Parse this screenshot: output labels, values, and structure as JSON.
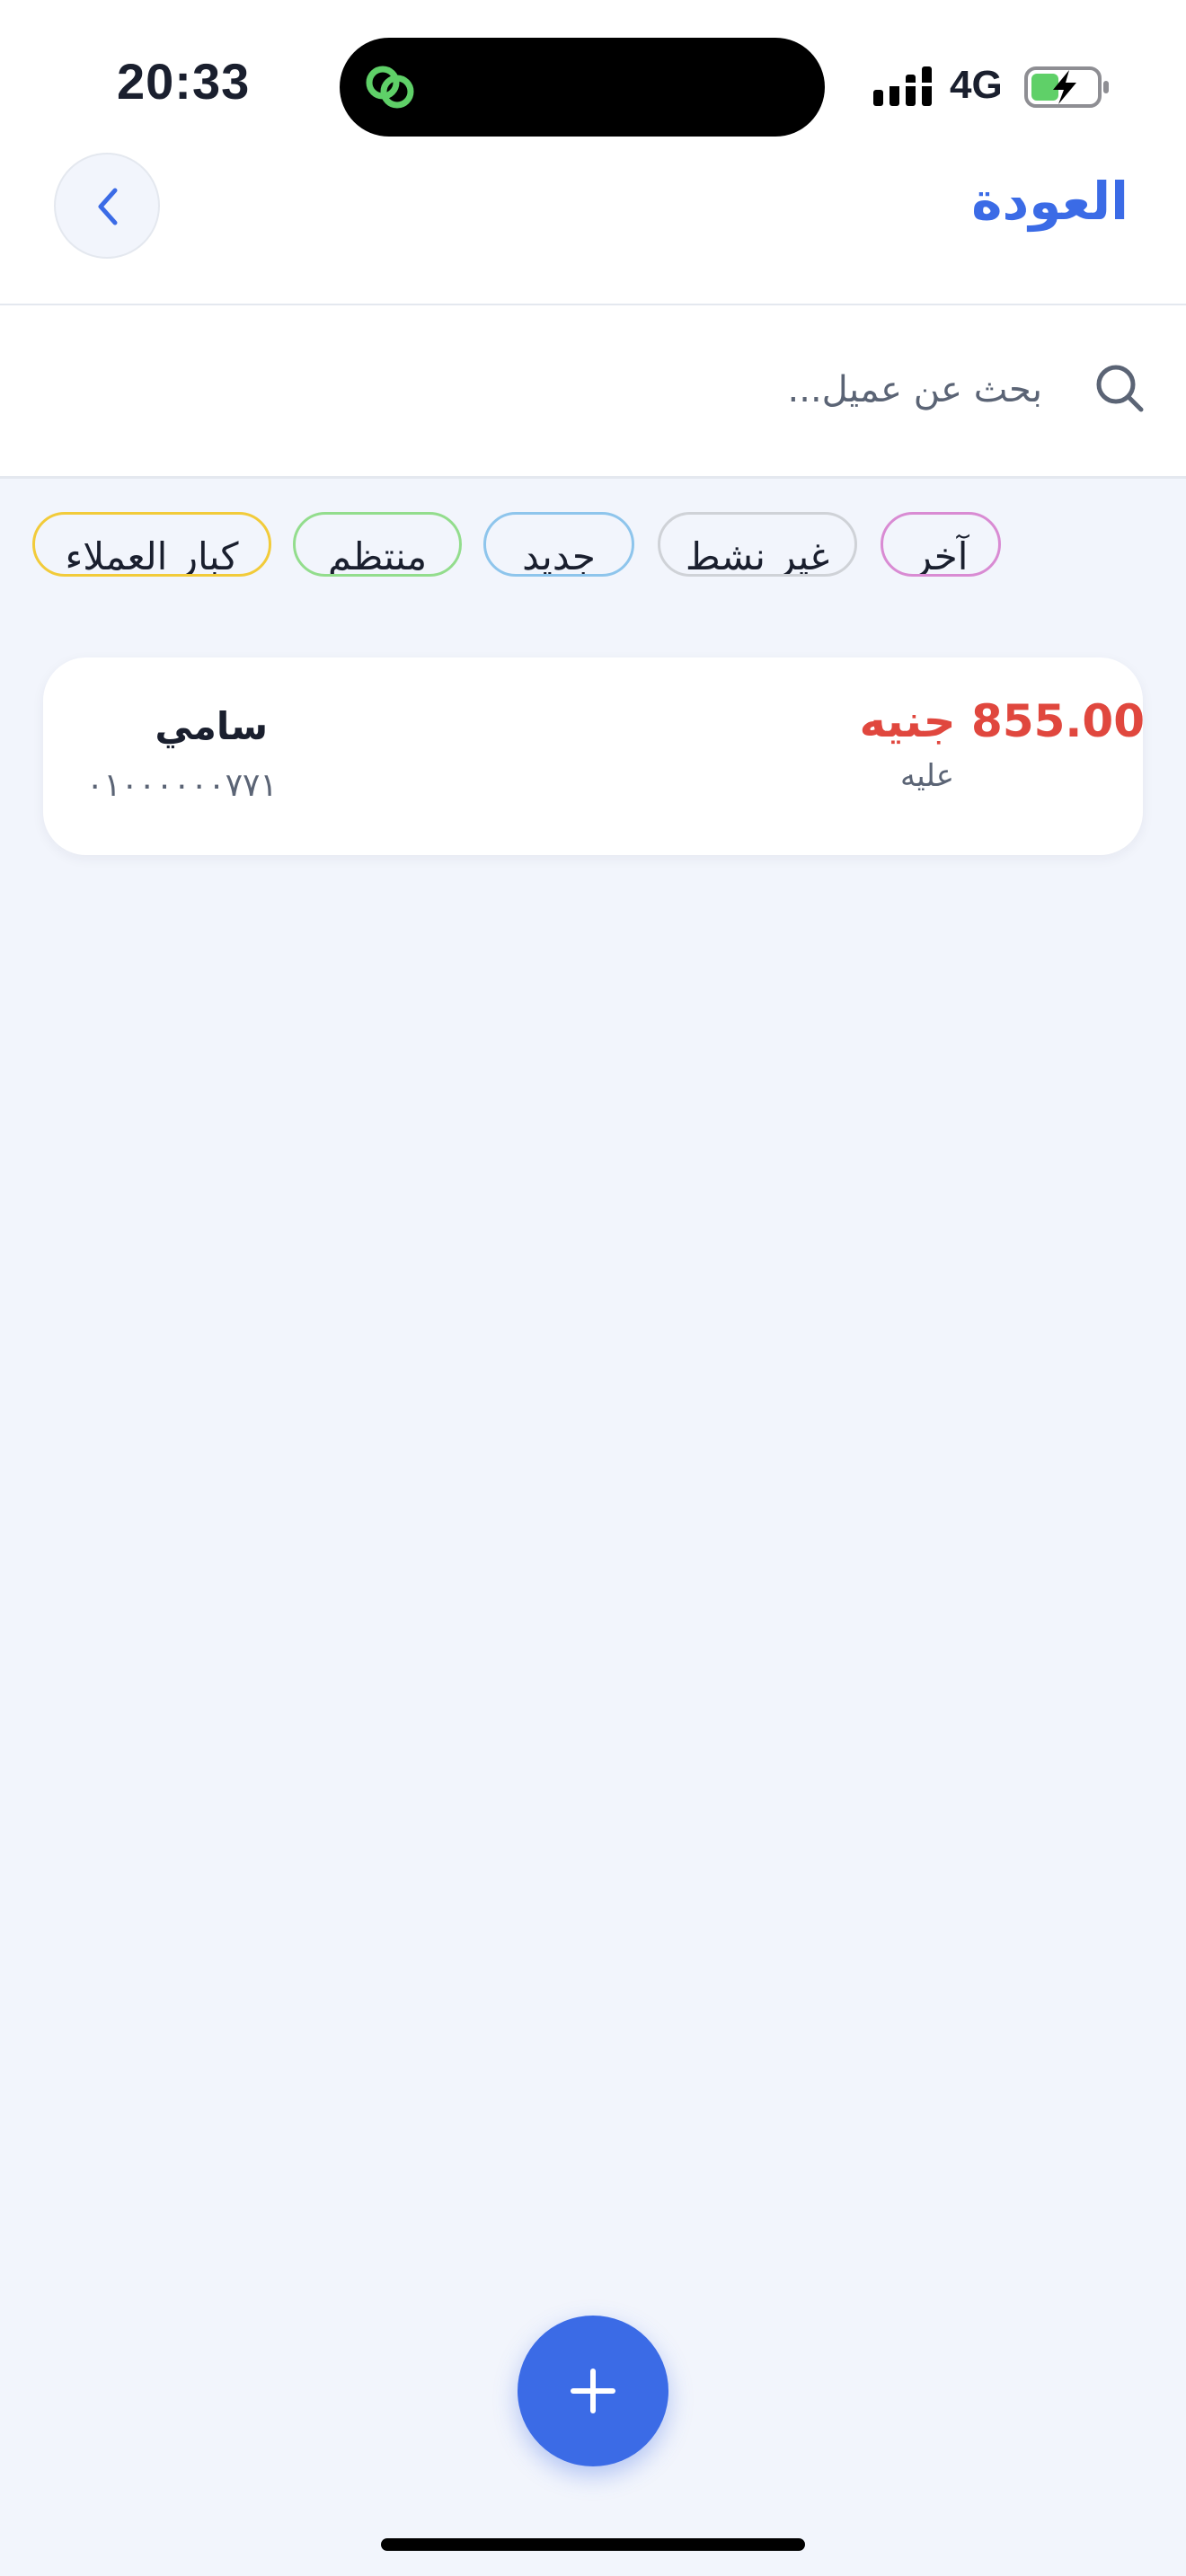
{
  "status_bar": {
    "time": "20:33",
    "network": "4G",
    "icons": [
      "signal-icon",
      "battery-charging-icon",
      "link-icon"
    ]
  },
  "header": {
    "back_label": "العودة",
    "back_icon": "chevron-left-icon"
  },
  "search": {
    "placeholder": "بحث عن عميل...",
    "value": "",
    "icon": "search-icon"
  },
  "filters": [
    {
      "label": "كبار العملاء",
      "color": "#f2cb3a"
    },
    {
      "label": "منتظم",
      "color": "#93dd8d"
    },
    {
      "label": "جديد",
      "color": "#8ec5ec"
    },
    {
      "label": "غير نشط",
      "color": "#cfd2d7"
    },
    {
      "label": "آخر",
      "color": "#d98bd3"
    }
  ],
  "customers": [
    {
      "name": "سامي",
      "phone": "٠١٠٠٠٠٠٠٧٧١",
      "balance": "855.00 جنيه",
      "balance_label": "عليه",
      "balance_color": "#e0473e"
    }
  ],
  "fab": {
    "icon": "plus-icon"
  },
  "colors": {
    "accent": "#3b6be6",
    "background": "#f2f5fc",
    "danger": "#e0473e"
  }
}
